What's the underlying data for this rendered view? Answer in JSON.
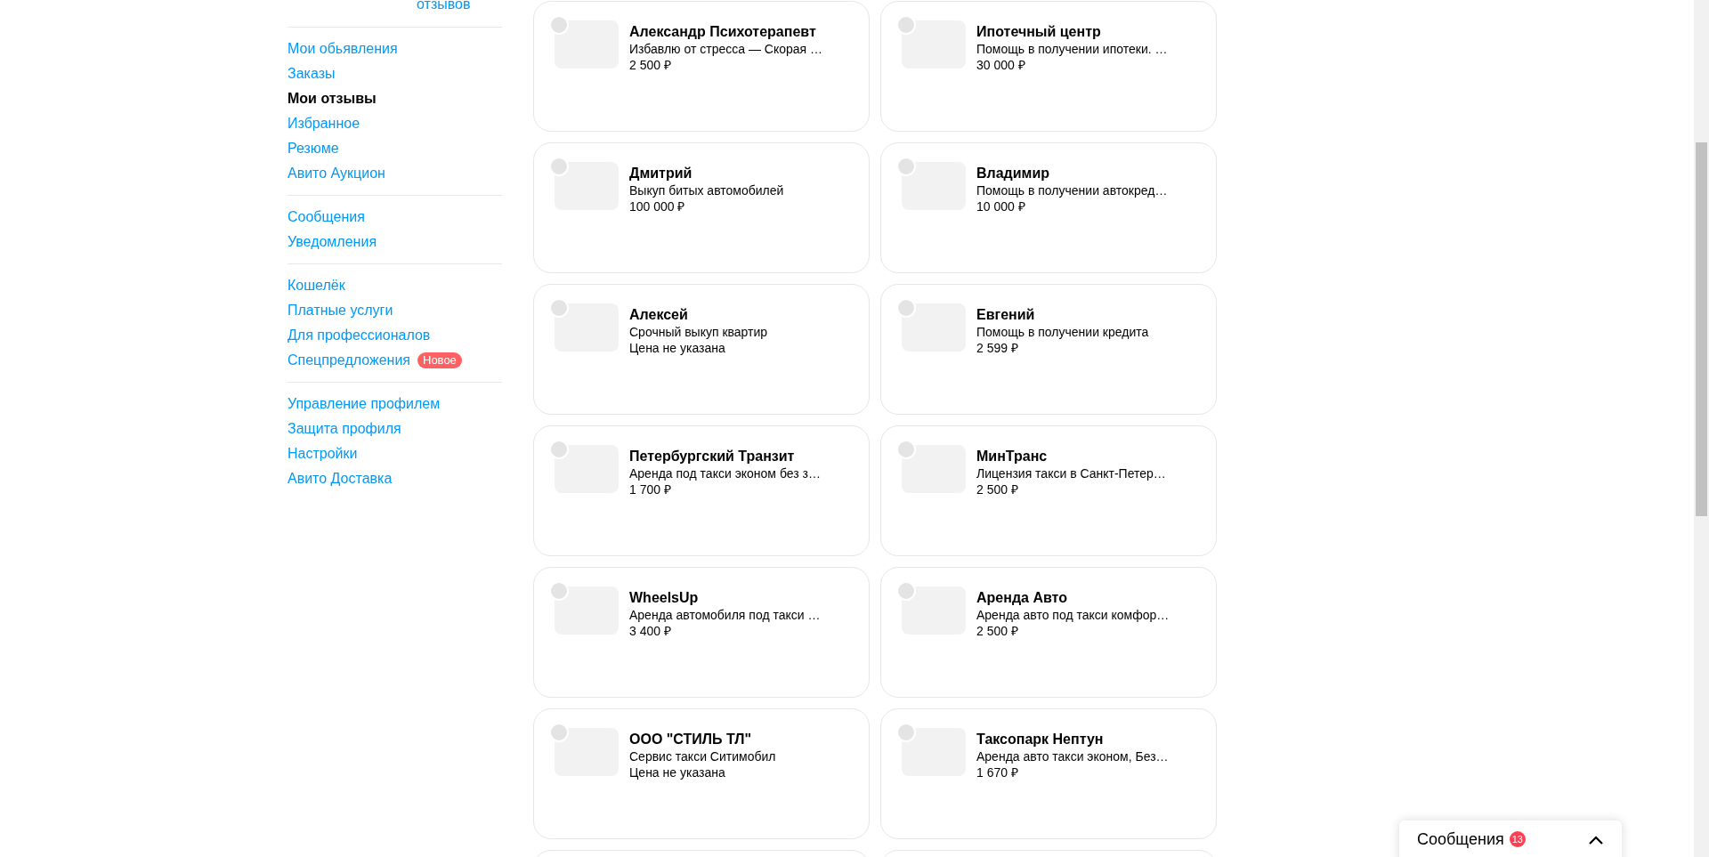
{
  "sidebar": {
    "reviews_link": "отзывов",
    "groups": [
      {
        "items": [
          {
            "label": "Мои обьявления",
            "selected": false
          },
          {
            "label": "Заказы",
            "selected": false
          },
          {
            "label": "Мои отзывы",
            "selected": true
          },
          {
            "label": "Избранное",
            "selected": false
          },
          {
            "label": "Резюме",
            "selected": false
          },
          {
            "label": "Авито Аукцион",
            "selected": false
          }
        ]
      },
      {
        "items": [
          {
            "label": "Сообщения",
            "selected": false
          },
          {
            "label": "Уведомления",
            "selected": false
          }
        ]
      },
      {
        "items": [
          {
            "label": "Кошелёк",
            "selected": false
          },
          {
            "label": "Платные услуги",
            "selected": false
          },
          {
            "label": "Для профессионалов",
            "selected": false
          },
          {
            "label": "Спецпредложения",
            "selected": false,
            "badge": "Новое"
          }
        ]
      },
      {
        "items": [
          {
            "label": "Управление профилем",
            "selected": false
          },
          {
            "label": "Защита профиля",
            "selected": false
          },
          {
            "label": "Настройки",
            "selected": false
          },
          {
            "label": "Авито Доставка",
            "selected": false
          }
        ]
      }
    ]
  },
  "cards": [
    {
      "title": "Александр Психотерапевт",
      "description": "Избавлю от стресса — Скорая …",
      "price": "2 500 ₽"
    },
    {
      "title": "Ипотечный центр",
      "description": "Помощь в получении ипотеки. …",
      "price": "30 000 ₽"
    },
    {
      "title": "Дмитрий",
      "description": "Выкуп битых автомобилей",
      "price": "100 000 ₽"
    },
    {
      "title": "Владимир",
      "description": "Помощь в получении автокред…",
      "price": "10 000 ₽"
    },
    {
      "title": "Алексей",
      "description": "Срочный выкуп квартир",
      "price": "Цена не указана"
    },
    {
      "title": "Евгений",
      "description": "Помощь в получении кредита",
      "price": "2 599 ₽"
    },
    {
      "title": "Петербургский Транзит",
      "description": "Аренда под такси эконом без з…",
      "price": "1 700 ₽"
    },
    {
      "title": "МинТранс",
      "description": "Лицензия такси в Санкт-Петер…",
      "price": "2 500 ₽"
    },
    {
      "title": "WheelsUp",
      "description": "Аренда автомобиля под такси …",
      "price": "3 400 ₽"
    },
    {
      "title": "Аренда Авто",
      "description": "Аренда авто под такси комфор…",
      "price": "2 500 ₽"
    },
    {
      "title": "ООО \"СТИЛЬ ТЛ\"",
      "description": "Сервис такси Ситимобил",
      "price": "Цена не указана"
    },
    {
      "title": "Таксопарк Нептун",
      "description": "Аренда авто такси эконом, Без…",
      "price": "1 670 ₽"
    }
  ],
  "messages_widget": {
    "title": "Сообщения",
    "count": "13"
  }
}
